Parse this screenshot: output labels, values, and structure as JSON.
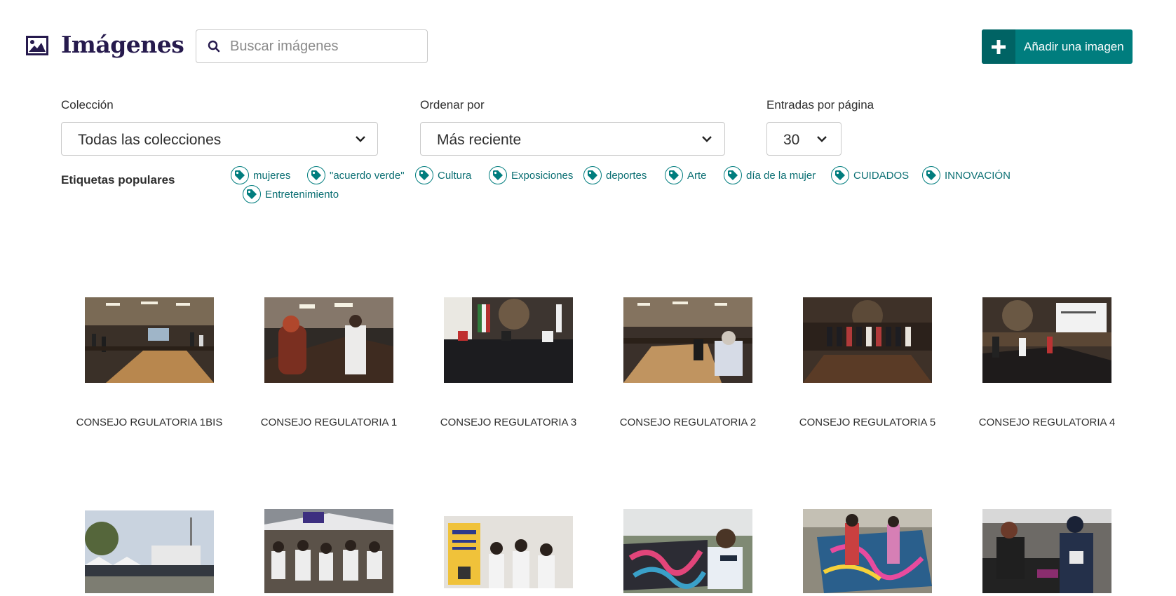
{
  "header": {
    "title": "Imágenes",
    "title_icon": "image-icon",
    "search_placeholder": "Buscar imágenes",
    "search_value": "",
    "search_icon": "search-icon",
    "add_button_label": "Añadir una imagen",
    "add_button_icon": "plus-icon",
    "accent_color": "#007d7e"
  },
  "filters": {
    "collection": {
      "label": "Colección",
      "value": "Todas las colecciones"
    },
    "order": {
      "label": "Ordenar por",
      "value": "Más reciente"
    },
    "per_page": {
      "label": "Entradas por página",
      "value": "30"
    }
  },
  "tags": {
    "label": "Etiquetas populares",
    "items": [
      "mujeres",
      "\"acuerdo verde\"",
      "Cultura",
      "Exposiciones",
      "deportes",
      "Arte",
      "día de la mujer",
      "CUIDADOS",
      "INNOVACIÓN",
      "Entretenimiento"
    ]
  },
  "gallery": {
    "row1": [
      "CONSEJO RGULATORIA 1BIS",
      "CONSEJO REGULATORIA 1",
      "CONSEJO REGULATORIA 3",
      "CONSEJO REGULATORIA 2",
      "CONSEJO REGULATORIA 5",
      "CONSEJO REGULATORIA 4"
    ]
  }
}
